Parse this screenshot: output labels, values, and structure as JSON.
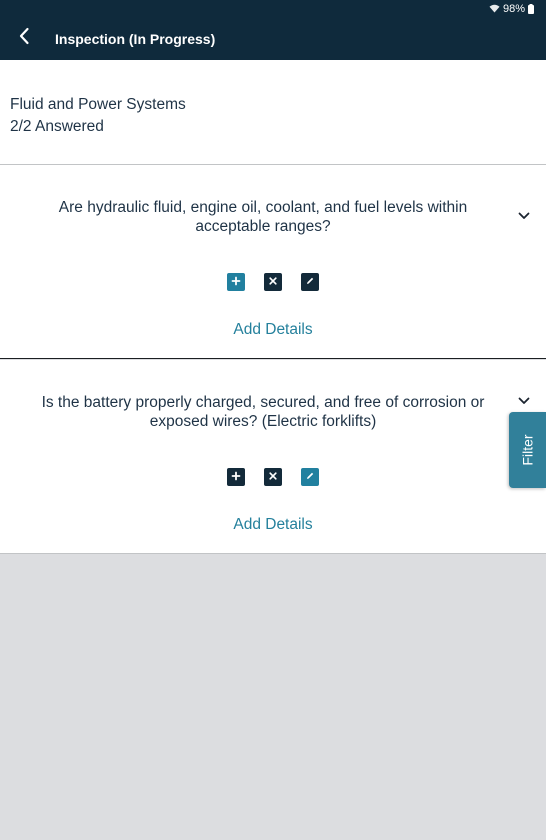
{
  "status_bar": {
    "battery": "98%"
  },
  "app_bar": {
    "title": "Inspection (In Progress)"
  },
  "section": {
    "title": "Fluid and Power Systems",
    "answered": "2/2 Answered"
  },
  "questions": [
    {
      "text": "Are hydraulic fluid, engine oil, coolant, and fuel levels within acceptable ranges?",
      "add_details_label": "Add Details",
      "selected_action": "plus",
      "actions": [
        "plus-icon",
        "close-icon",
        "pencil-icon"
      ]
    },
    {
      "text": "Is the battery properly charged, secured, and free of corrosion or exposed wires? (Electric forklifts)",
      "add_details_label": "Add Details",
      "selected_action": "pencil",
      "actions": [
        "plus-icon",
        "close-icon",
        "pencil-icon"
      ]
    }
  ],
  "filter": {
    "label": "Filter"
  },
  "colors": {
    "app_bar": "#0f2a3c",
    "accent": "#21809f",
    "text": "#1f3346",
    "background": "#dcdde0"
  }
}
